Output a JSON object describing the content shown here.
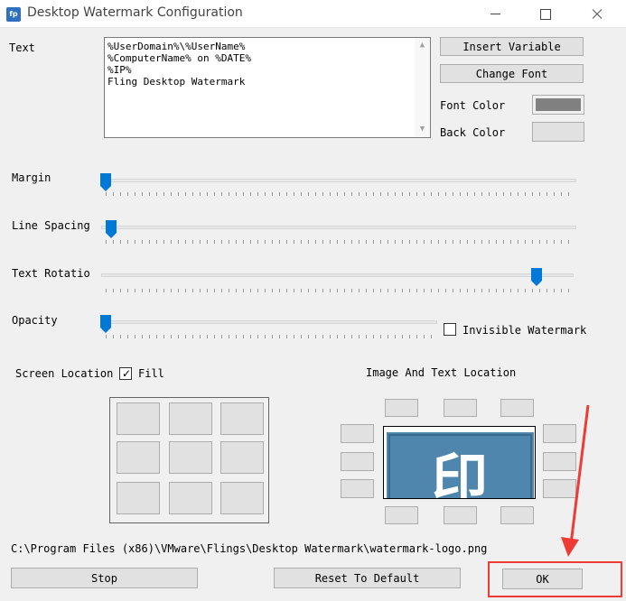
{
  "window": {
    "title": "Desktop Watermark Configuration",
    "icon_text": "fp",
    "app_icon": "app-icon",
    "controls": [
      "minimize-icon",
      "maximize-icon",
      "close-icon"
    ]
  },
  "text_section": {
    "label": "Text",
    "lines": [
      "%UserDomain%\\%UserName%",
      "%ComputerName% on %DATE%",
      "%IP%",
      "Fling Desktop Watermark"
    ]
  },
  "buttons": {
    "insert_variable": "Insert Variable",
    "change_font": "Change Font",
    "stop": "Stop",
    "reset_default": "Reset To Default",
    "ok": "OK"
  },
  "colors": {
    "font_color_label": "Font Color",
    "font_color_value": "#808080",
    "back_color_label": "Back Color",
    "back_color_value": "#e1e1e1",
    "accent": "#0078d7",
    "highlight": "#ef3b36"
  },
  "sliders": {
    "margin": {
      "label": "Margin",
      "level": 0.0
    },
    "line_spacing": {
      "label": "Line Spacing",
      "level": 0.01
    },
    "text_rotation": {
      "label": "Text Rotatio",
      "level": 0.92
    },
    "opacity": {
      "label": "Opacity",
      "level": 0.0
    }
  },
  "invisible_watermark": {
    "label": "Invisible Watermark",
    "checked": false
  },
  "screen_location": {
    "label": "Screen Location",
    "fill_label": "Fill",
    "fill_checked": true
  },
  "image_text_location": {
    "label": "Image And Text Location"
  },
  "logo_image": {
    "glyph": "印"
  },
  "file_path": "C:\\Program Files (x86)\\VMware\\Flings\\Desktop Watermark\\watermark-logo.png"
}
